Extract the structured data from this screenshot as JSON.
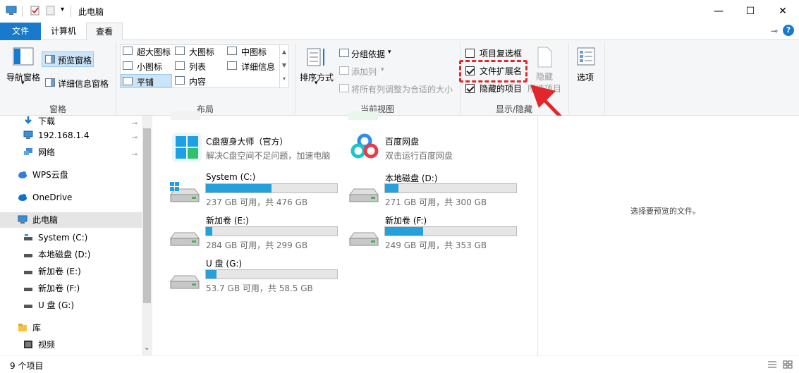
{
  "window": {
    "title": "此电脑",
    "minimize": "—",
    "maximize": "☐",
    "close": "✕"
  },
  "tabs": {
    "file": "文件",
    "computer": "计算机",
    "view": "查看",
    "pin_glyph": "⊸",
    "help_glyph": "?"
  },
  "ribbon": {
    "pane_group": {
      "label": "窗格",
      "nav_pane": "导航窗格",
      "preview_pane": "预览窗格",
      "details_pane": "详细信息窗格"
    },
    "layout_group": {
      "label": "布局",
      "items": [
        "超大图标",
        "大图标",
        "中图标",
        "小图标",
        "列表",
        "详细信息",
        "平铺",
        "内容"
      ]
    },
    "current_view_group": {
      "label": "当前视图",
      "sort_by": "排序方式",
      "group_by": "分组依据",
      "add_columns": "添加列",
      "fit_columns": "将所有列调整为合适的大小"
    },
    "show_hide_group": {
      "label": "显示/隐藏",
      "item_checkboxes": "项目复选框",
      "item_checkboxes_checked": false,
      "file_extensions": "文件扩展名",
      "file_extensions_checked": true,
      "hidden_items": "隐藏的项目",
      "hidden_items_checked": true,
      "hide_selected_1": "隐藏",
      "hide_selected_2": "所选项目"
    },
    "options": "选项"
  },
  "nav": {
    "items": [
      {
        "label": "下载",
        "icon": "download-arrow-icon",
        "pinned": true
      },
      {
        "label": "192.168.1.4",
        "icon": "monitor-icon",
        "pinned": true
      },
      {
        "label": "网络",
        "icon": "network-icon",
        "pinned": true
      },
      {
        "label": "WPS云盘",
        "icon": "cloud-icon"
      },
      {
        "label": "OneDrive",
        "icon": "cloud-icon"
      },
      {
        "label": "此电脑",
        "icon": "monitor-icon"
      },
      {
        "label": "System (C:)",
        "icon": "drive-icon"
      },
      {
        "label": "本地磁盘 (D:)",
        "icon": "drive-icon"
      },
      {
        "label": "新加卷 (E:)",
        "icon": "drive-icon"
      },
      {
        "label": "新加卷 (F:)",
        "icon": "drive-icon"
      },
      {
        "label": "U 盘 (G:)",
        "icon": "drive-icon"
      },
      {
        "label": "库",
        "icon": "library-icon"
      },
      {
        "label": "视频",
        "icon": "video-icon"
      }
    ],
    "pin_glyph": "📌"
  },
  "apps": [
    {
      "name": "C盘瘦身大师（官方）",
      "desc": "解决C盘空间不足问题，加速电脑"
    },
    {
      "name": "百度网盘",
      "desc": "双击运行百度网盘"
    }
  ],
  "drives": [
    {
      "name": "System (C:)",
      "info": "237 GB 可用，共 476 GB",
      "used_fraction": 0.5
    },
    {
      "name": "本地磁盘 (D:)",
      "info": "271 GB 可用，共 300 GB",
      "used_fraction": 0.1
    },
    {
      "name": "新加卷 (E:)",
      "info": "284 GB 可用，共 299 GB",
      "used_fraction": 0.05
    },
    {
      "name": "新加卷 (F:)",
      "info": "249 GB 可用，共 353 GB",
      "used_fraction": 0.29
    },
    {
      "name": "U 盘 (G:)",
      "info": "53.7 GB 可用，共 58.5 GB",
      "used_fraction": 0.08
    }
  ],
  "preview": {
    "message": "选择要预览的文件。"
  },
  "status": {
    "count": "9 个项目"
  },
  "colors": {
    "accent": "#1979ca",
    "drive_fill": "#26a0da",
    "annotation": "#e3262b"
  }
}
